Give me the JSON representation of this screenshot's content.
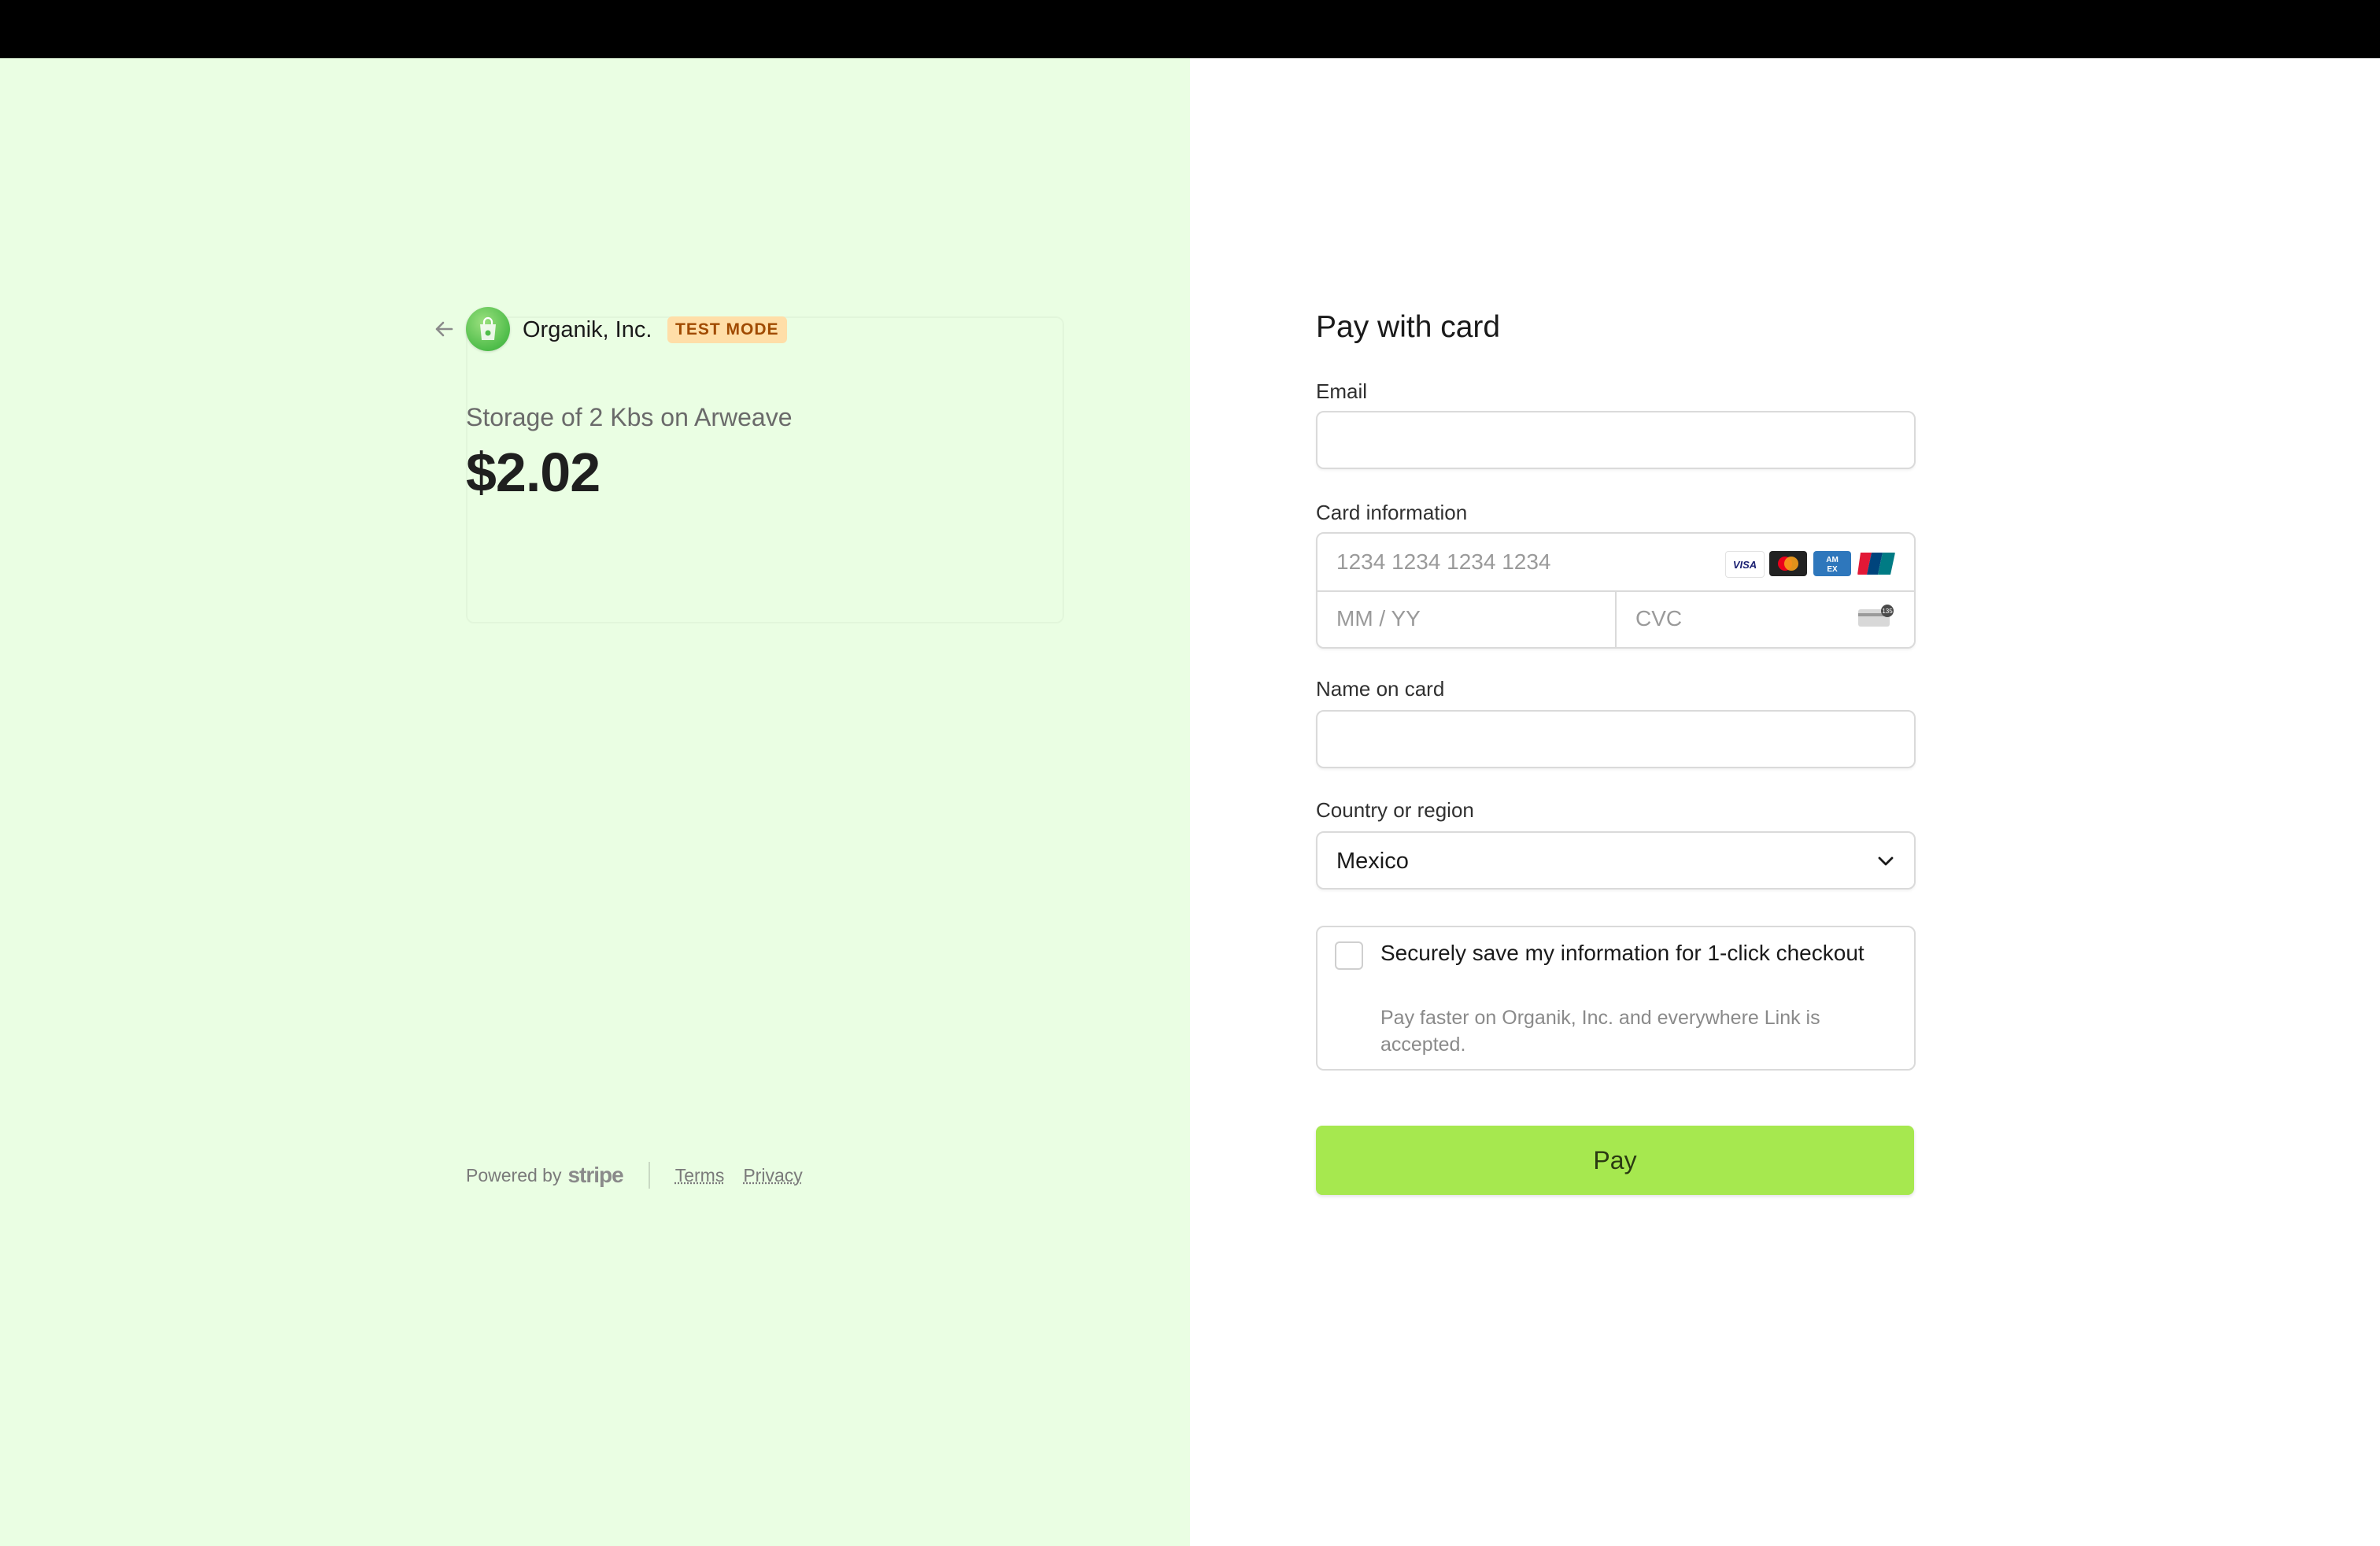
{
  "merchant": {
    "name": "Organik, Inc.",
    "badge": "TEST MODE"
  },
  "order": {
    "product": "Storage of 2 Kbs on Arweave",
    "amount": "$2.02"
  },
  "footer": {
    "powered_by": "Powered by",
    "stripe": "stripe",
    "terms": "Terms",
    "privacy": "Privacy"
  },
  "form": {
    "title": "Pay with card",
    "email_label": "Email",
    "email_value": "",
    "card_label": "Card information",
    "card_number_placeholder": "1234 1234 1234 1234",
    "expiry_placeholder": "MM / YY",
    "cvc_placeholder": "CVC",
    "card_brands": [
      "visa-icon",
      "mastercard-icon",
      "amex-icon",
      "unionpay-icon"
    ],
    "name_label": "Name on card",
    "name_value": "",
    "country_label": "Country or region",
    "country_value": "Mexico",
    "save_title": "Securely save my information for 1-click checkout",
    "save_subtitle": "Pay faster on Organik, Inc. and everywhere Link is accepted.",
    "save_checked": false,
    "pay_label": "Pay"
  },
  "colors": {
    "left_background": "#eafee3",
    "pay_button": "#a6e84f",
    "badge_background": "#ffdea8",
    "badge_text": "#a04a00"
  }
}
